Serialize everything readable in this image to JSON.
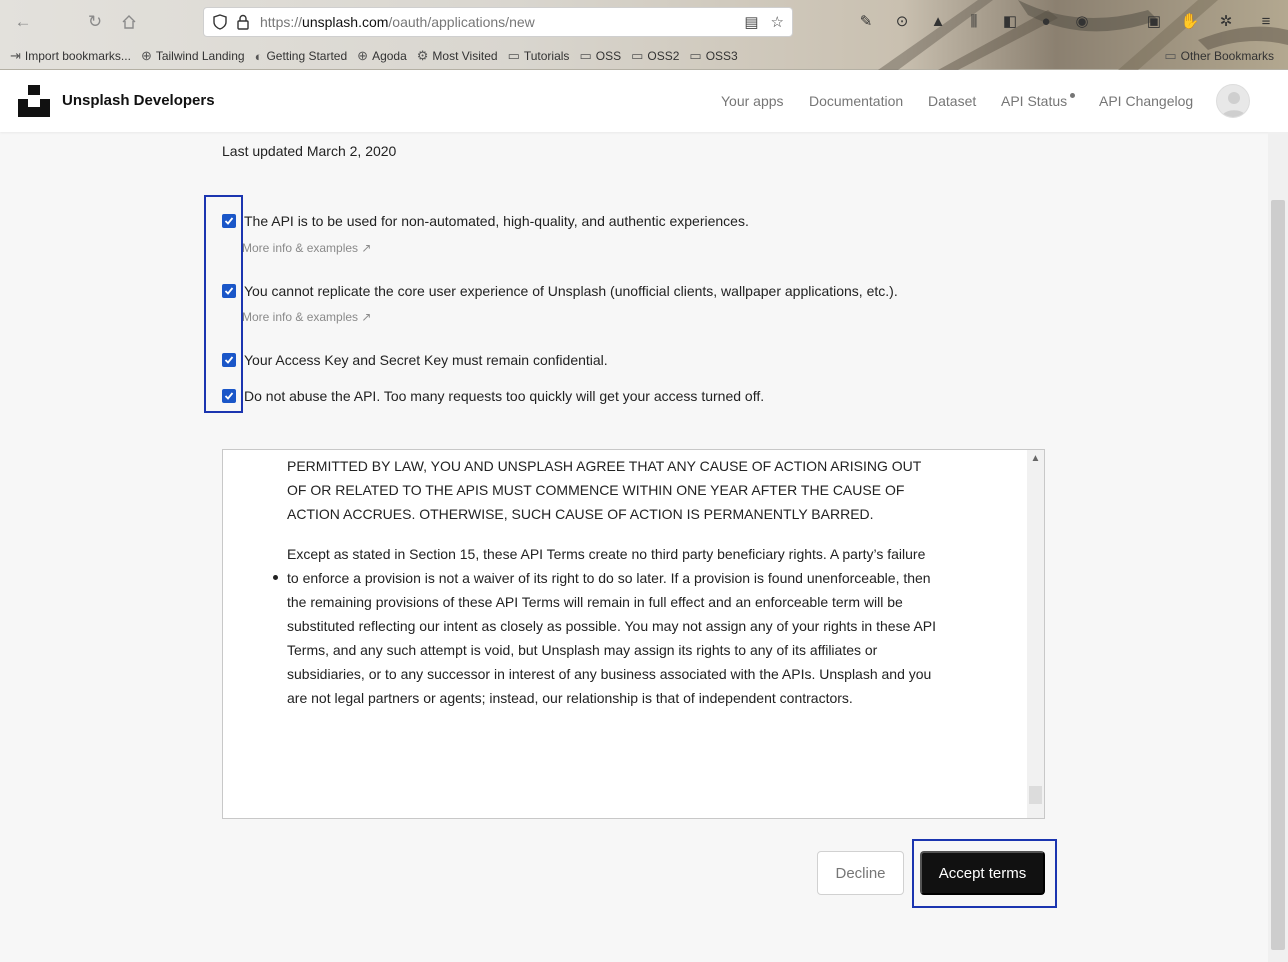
{
  "browser": {
    "url_prefix": "https://",
    "url_host": "unsplash.com",
    "url_path": "/oauth/applications/new",
    "bookmarks": [
      {
        "label": "Import bookmarks...",
        "icon": "import-icon"
      },
      {
        "label": "Tailwind Landing",
        "icon": "globe-icon"
      },
      {
        "label": "Getting Started",
        "icon": "firefox-icon"
      },
      {
        "label": "Agoda",
        "icon": "globe-icon"
      },
      {
        "label": "Most Visited",
        "icon": "gear-icon"
      },
      {
        "label": "Tutorials",
        "icon": "folder-icon"
      },
      {
        "label": "OSS",
        "icon": "folder-icon"
      },
      {
        "label": "OSS2",
        "icon": "folder-icon"
      },
      {
        "label": "OSS3",
        "icon": "folder-icon"
      }
    ],
    "other_bookmarks": "Other Bookmarks"
  },
  "header": {
    "brand": "Unsplash Developers",
    "nav": {
      "your_apps": "Your apps",
      "documentation": "Documentation",
      "dataset": "Dataset",
      "api_status": "API Status",
      "api_changelog": "API Changelog"
    }
  },
  "main": {
    "last_updated": "Last updated March 2, 2020",
    "rules": [
      {
        "text": "The API is to be used for non-automated, high-quality, and authentic experiences.",
        "checked": true,
        "more": "More info & examples ↗"
      },
      {
        "text": "You cannot replicate the core user experience of Unsplash (unofficial clients, wallpaper applications, etc.).",
        "checked": true,
        "more": "More info & examples ↗"
      },
      {
        "text": "Your Access Key and Secret Key must remain confidential.",
        "checked": true
      },
      {
        "text": "Do not abuse the API. Too many requests too quickly will get your access turned off.",
        "checked": true
      }
    ],
    "terms": {
      "para1": "PERMITTED BY LAW, YOU AND UNSPLASH AGREE THAT ANY CAUSE OF ACTION ARISING OUT OF OR RELATED TO THE APIS MUST COMMENCE WITHIN ONE YEAR AFTER THE CAUSE OF ACTION ACCRUES. OTHERWISE, SUCH CAUSE OF ACTION IS PERMANENTLY BARRED.",
      "para2": "Except as stated in Section 15, these API Terms create no third party beneficiary rights. A party’s failure to enforce a provision is not a waiver of its right to do so later. If a provision is found unenforceable, then the remaining provisions of these API Terms will remain in full effect and an enforceable term will be substituted reflecting our intent as closely as possible. You may not assign any of your rights in these API Terms, and any such attempt is void, but Unsplash may assign its rights to any of its affiliates or subsidiaries, or to any successor in interest of any business associated with the APIs. Unsplash and you are not legal partners or agents; instead, our relationship is that of independent contractors."
    },
    "buttons": {
      "decline": "Decline",
      "accept": "Accept terms"
    }
  },
  "colors": {
    "accent": "#1a56c8",
    "highlight": "#1b35b0",
    "accept_bg": "#111111"
  }
}
